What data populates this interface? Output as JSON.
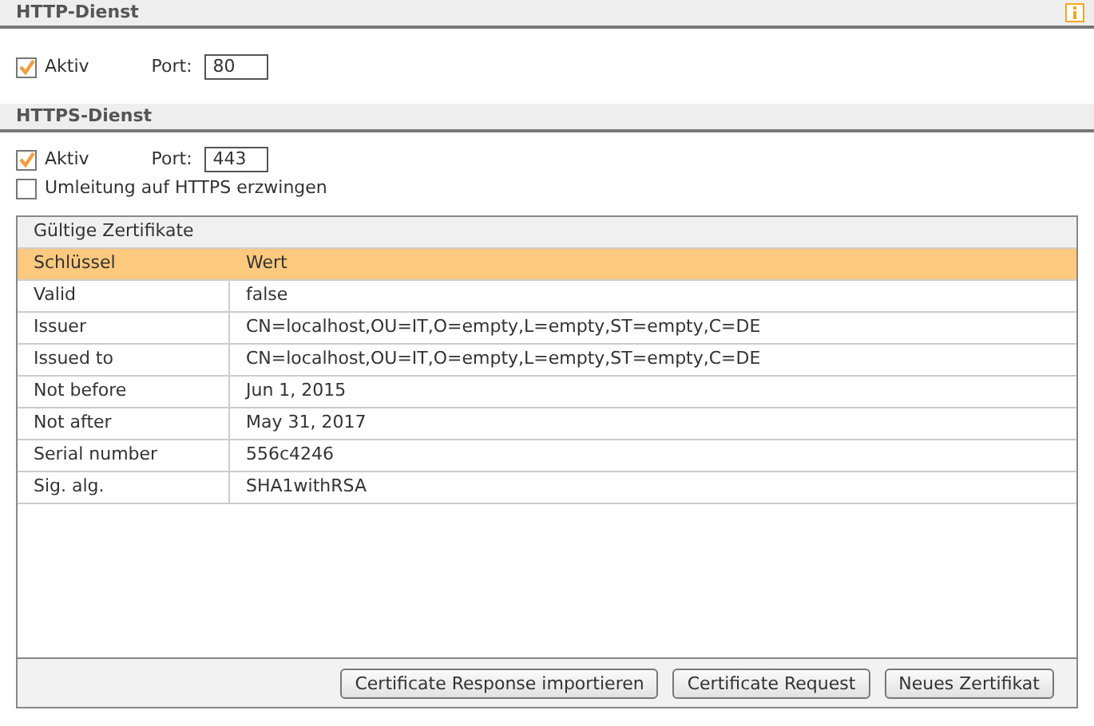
{
  "sections": [
    {
      "title": "HTTP-Dienst",
      "info_icon": true,
      "active": {
        "label": "Aktiv",
        "checked": true
      },
      "port": {
        "label": "Port:",
        "value": "80"
      }
    },
    {
      "title": "HTTPS-Dienst",
      "info_icon": false,
      "active": {
        "label": "Aktiv",
        "checked": true
      },
      "port": {
        "label": "Port:",
        "value": "443"
      },
      "redirect": {
        "label": "Umleitung auf HTTPS erzwingen",
        "checked": false
      },
      "certificates": {
        "title": "Gültige Zertifikate",
        "columns": [
          "Schlüssel",
          "Wert"
        ],
        "rows": [
          [
            "Valid",
            "false"
          ],
          [
            "Issuer",
            "CN=localhost,OU=IT,O=empty,L=empty,ST=empty,C=DE"
          ],
          [
            "Issued to",
            "CN=localhost,OU=IT,O=empty,L=empty,ST=empty,C=DE"
          ],
          [
            "Not before",
            "Jun 1, 2015"
          ],
          [
            "Not after",
            "May 31, 2017"
          ],
          [
            "Serial number",
            "556c4246"
          ],
          [
            "Sig. alg.",
            "SHA1withRSA"
          ]
        ],
        "buttons": [
          "Certificate Response importieren",
          "Certificate Request",
          "Neues Zertifikat"
        ]
      }
    }
  ]
}
